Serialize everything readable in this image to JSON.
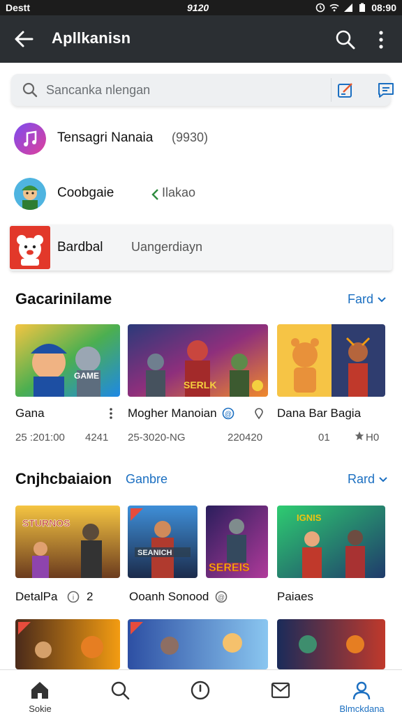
{
  "status_bar": {
    "left_text": "Destt",
    "center_text": "9120",
    "right_text": "08:90"
  },
  "app_bar": {
    "title": "Apllkanisn"
  },
  "search": {
    "placeholder": "Sancanka nlengan"
  },
  "suggestions": [
    {
      "name": "Tensagri Nanaia",
      "meta": "(9930)"
    },
    {
      "name": "Coobgaie",
      "meta": "Ilakao"
    },
    {
      "name": "Bardbal",
      "meta": "Uangerdiayn"
    }
  ],
  "section1": {
    "title": "Gacarinilame",
    "link": "Fard",
    "cards": [
      {
        "title": "Gana",
        "meta_left": "25 :201:00",
        "meta_right": "4241"
      },
      {
        "title": "Mogher Manoian",
        "meta_left": "25-3020-NG",
        "meta_right": "220420"
      },
      {
        "title": "Dana Bar Bagia",
        "meta_left": "01",
        "meta_right": "H0"
      }
    ]
  },
  "section2": {
    "title": "Cnjhcbaiaion",
    "subtitle": "Ganbre",
    "link": "Rard",
    "cards": [
      {
        "title": "DetalPa",
        "meta": "2"
      },
      {
        "title": "Ooanh Sonood",
        "meta": ""
      },
      {
        "title": "Paiaes",
        "meta": ""
      }
    ]
  },
  "bottom_nav": [
    {
      "label": "Sokie",
      "icon": "home-icon"
    },
    {
      "label": "",
      "icon": "search-icon"
    },
    {
      "label": "",
      "icon": "compass-icon"
    },
    {
      "label": "",
      "icon": "mail-icon"
    },
    {
      "label": "Blmckdana",
      "icon": "profile-icon"
    }
  ],
  "colors": {
    "accent": "#1b6fc1",
    "appbar": "#2b2f33"
  }
}
